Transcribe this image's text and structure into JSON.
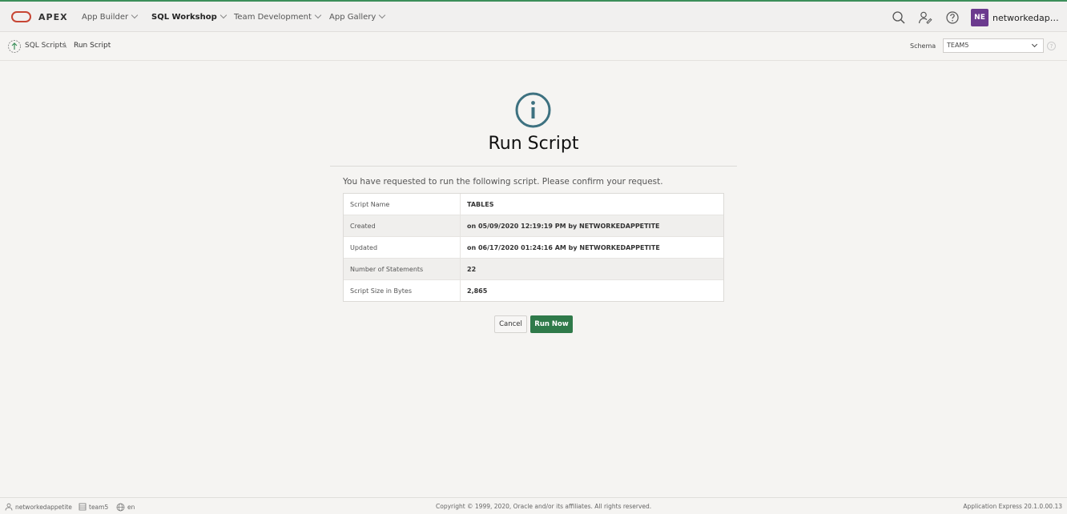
{
  "header": {
    "brand": "APEX",
    "menus": [
      {
        "label": "App Builder"
      },
      {
        "label": "SQL Workshop"
      },
      {
        "label": "Team Development"
      },
      {
        "label": "App Gallery"
      }
    ],
    "avatar_initials": "NE",
    "username": "networkedappetite"
  },
  "breadcrumb": {
    "parent": "SQL Scripts",
    "current": "Run Script"
  },
  "schema": {
    "label": "Schema",
    "value": "TEAM5"
  },
  "main": {
    "title": "Run Script",
    "confirm_text": "You have requested to run the following script. Please confirm your request.",
    "rows": [
      {
        "label": "Script Name",
        "value": "TABLES"
      },
      {
        "label": "Created",
        "value": "on 05/09/2020 12:19:19 PM by NETWORKEDAPPETITE"
      },
      {
        "label": "Updated",
        "value": "on 06/17/2020 01:24:16 AM by NETWORKEDAPPETITE"
      },
      {
        "label": "Number of Statements",
        "value": "22"
      },
      {
        "label": "Script Size in Bytes",
        "value": "2,865"
      }
    ],
    "cancel_label": "Cancel",
    "run_label": "Run Now"
  },
  "footer": {
    "user": "networkedappetite",
    "workspace": "team5",
    "language": "en",
    "copyright": "Copyright © 1999, 2020, Oracle and/or its affiliates. All rights reserved.",
    "version": "Application Express 20.1.0.00.13"
  },
  "colors": {
    "accent": "#2f7a4a",
    "oracle_red": "#c74634",
    "info_icon": "#3d7180",
    "avatar": "#6b3a8e"
  }
}
